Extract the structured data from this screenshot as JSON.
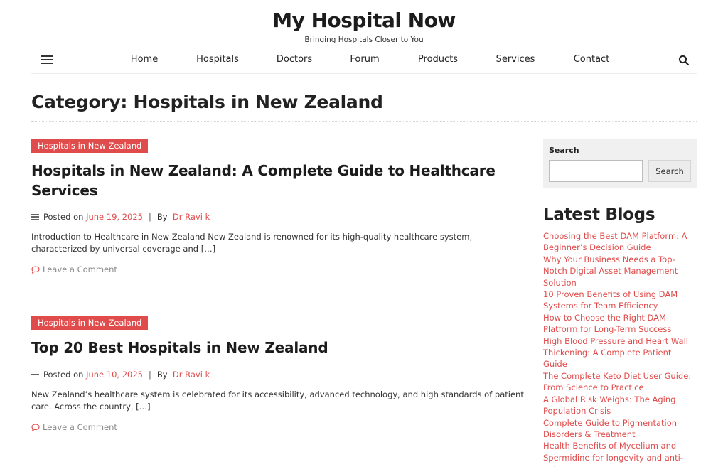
{
  "site": {
    "title": "My Hospital Now",
    "tagline": "Bringing Hospitals Closer to You"
  },
  "nav": {
    "menu_icon": "hamburger-icon",
    "search_icon": "search-icon",
    "items": [
      "Home",
      "Hospitals",
      "Doctors",
      "Forum",
      "Products",
      "Services",
      "Contact"
    ]
  },
  "page": {
    "title": "Category: Hospitals in New Zealand"
  },
  "posts": [
    {
      "category": "Hospitals in New Zealand",
      "title": "Hospitals in New Zealand: A Complete Guide to Healthcare Services",
      "posted_on_label": "Posted on",
      "date": "June 19, 2025",
      "separator": "|",
      "by_label": "By",
      "author": "Dr Ravi k",
      "excerpt": "Introduction to Healthcare in New Zealand New Zealand is renowned for its high-quality healthcare system, characterized by universal coverage and […]",
      "comment_link": "Leave a Comment"
    },
    {
      "category": "Hospitals in New Zealand",
      "title": "Top 20 Best Hospitals in New Zealand",
      "posted_on_label": "Posted on",
      "date": "June 10, 2025",
      "separator": "|",
      "by_label": "By",
      "author": "Dr Ravi k",
      "excerpt": "New Zealand’s healthcare system is celebrated for its accessibility, advanced technology, and high standards of patient care. Across the country, […]",
      "comment_link": "Leave a Comment"
    }
  ],
  "sidebar": {
    "search": {
      "label": "Search",
      "input_value": "",
      "button": "Search"
    },
    "latest_blogs": {
      "title": "Latest Blogs",
      "items": [
        "Choosing the Best DAM Platform: A Beginner’s Decision Guide",
        "Why Your Business Needs a Top-Notch Digital Asset Management Solution",
        "10 Proven Benefits of Using DAM Systems for Team Efficiency",
        "How to Choose the Right DAM Platform for Long-Term Success",
        "High Blood Pressure and Heart Wall Thickening: A Complete Patient Guide",
        "The Complete Keto Diet User Guide: From Science to Practice",
        "A Global Risk Weighs: The Aging Population Crisis",
        "Complete Guide to Pigmentation Disorders & Treatment",
        "Health Benefits of Mycelium and Spermidine for longevity and anti-aging"
      ]
    }
  },
  "colors": {
    "accent": "#e04b4b",
    "text": "#222222",
    "muted": "#888888",
    "sidebar_bg": "#f0f0f0"
  }
}
